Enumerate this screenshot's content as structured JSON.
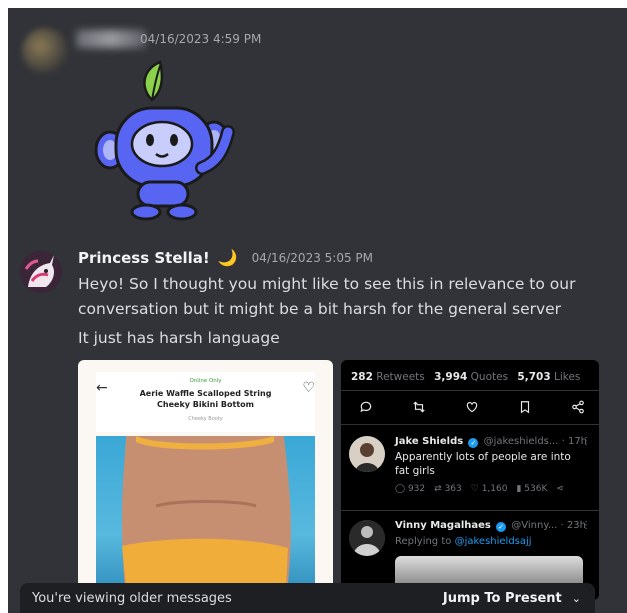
{
  "message1": {
    "timestamp": "04/16/2023 4:59 PM",
    "sticker": "wumpus-wave-sticker"
  },
  "message2": {
    "author": "Princess Stella!",
    "author_emoji": "🌙",
    "timestamp": "04/16/2023 5:05 PM",
    "lines": [
      "Heyo! So I thought you might like to see this in relevance to our conversation but it might be a bit harsh for the general server",
      "It just has harsh language"
    ]
  },
  "attachment_left": {
    "tag": "Online Only",
    "product_title": "Aerie Waffle Scalloped String Cheeky Bikini Bottom",
    "brand": "Cheeky Booty"
  },
  "attachment_right": {
    "stats": {
      "retweets": "282",
      "retweets_label": "Retweets",
      "quotes": "3,994",
      "quotes_label": "Quotes",
      "likes": "5,703",
      "likes_label": "Likes"
    },
    "tweets": [
      {
        "name": "Jake Shields",
        "handle": "@jakeshields...",
        "time": "· 17h",
        "text": "Apparently lots of people are into fat girls",
        "replies": "932",
        "retweets": "363",
        "likes": "1,160",
        "views": "536K"
      },
      {
        "name": "Vinny Magalhaes",
        "handle": "@Vinny...",
        "time": "· 23h",
        "replying_label": "Replying to",
        "replying_to": "@jakeshieldsajj"
      }
    ]
  },
  "banner": {
    "older_text": "You're viewing older messages",
    "jump_label": "Jump To Present"
  },
  "colors": {
    "background": "#313338",
    "banner": "#1e1f22",
    "link": "#1d9bf0"
  }
}
